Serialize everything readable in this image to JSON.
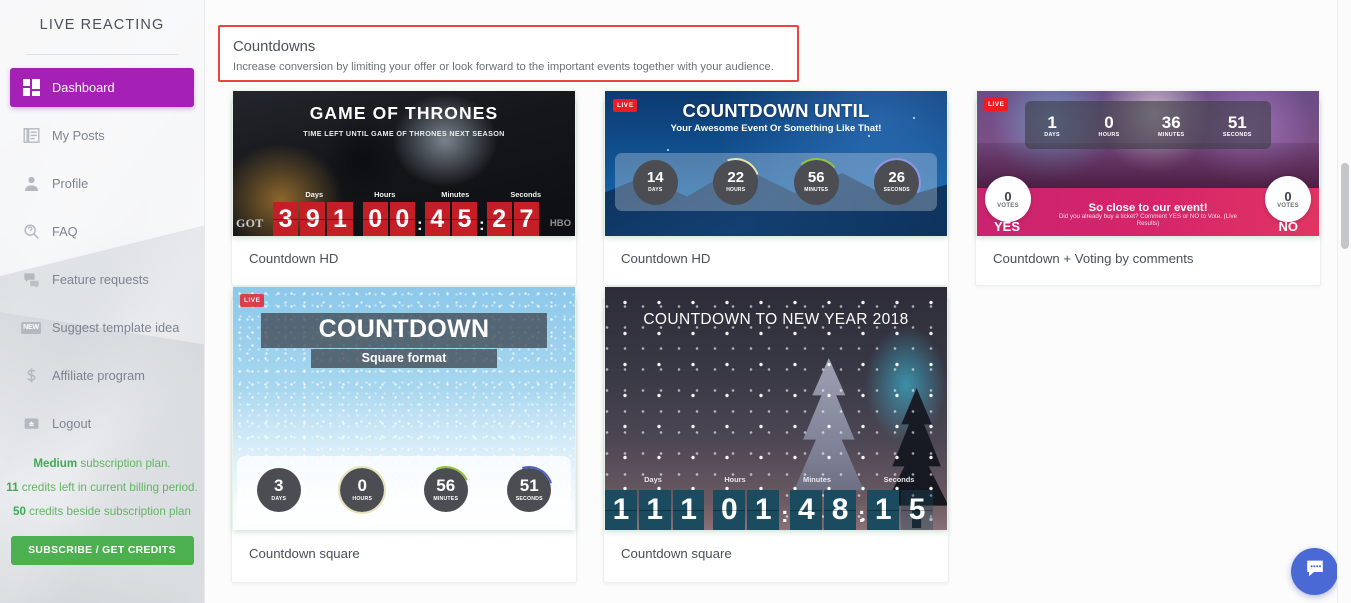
{
  "sidebar": {
    "brand": "LIVE REACTING",
    "items": [
      {
        "label": "Dashboard",
        "icon": "grid-icon",
        "active": true
      },
      {
        "label": "My Posts",
        "icon": "posts-icon",
        "active": false
      },
      {
        "label": "Profile",
        "icon": "person-icon",
        "active": false
      },
      {
        "label": "FAQ",
        "icon": "search-help-icon",
        "active": false
      },
      {
        "label": "Feature requests",
        "icon": "chat-bubbles-icon",
        "active": false
      },
      {
        "label": "Suggest template idea",
        "icon": "new-badge-icon",
        "active": false
      },
      {
        "label": "Affiliate program",
        "icon": "dollar-icon",
        "active": false
      },
      {
        "label": "Logout",
        "icon": "logout-icon",
        "active": false
      }
    ],
    "plan": {
      "line1_strong": "Medium",
      "line1_rest": " subscription plan.",
      "line2_strong": "11",
      "line2_rest": " credits left in current billing period.",
      "line3_strong": "50",
      "line3_rest": " credits beside subscription plan"
    },
    "subscribe_label": "SUBSCRIBE / GET CREDITS"
  },
  "section": {
    "title": "Countdowns",
    "subtitle": "Increase conversion by limiting your offer or look forward to the important events together with your audience.",
    "highlight_color": "#e8453c"
  },
  "colors": {
    "accent_purple": "#a520b4",
    "accent_green": "#4caf50",
    "plan_text_green": "#63b463",
    "chat_blue": "#4a69d4",
    "live_red": "#ed1c24"
  },
  "cards": [
    {
      "title": "Countdown HD"
    },
    {
      "title": "Countdown HD"
    },
    {
      "title": "Countdown + Voting by comments"
    },
    {
      "title": "Countdown square"
    },
    {
      "title": "Countdown square"
    }
  ],
  "templates": {
    "got": {
      "heading": "GAME OF THRONES",
      "subheading": "TIME LEFT UNTIL GAME OF THRONES NEXT SEASON",
      "labels": [
        "Days",
        "Hours",
        "Minutes",
        "Seconds"
      ],
      "digits": [
        "3",
        "9",
        "1",
        "0",
        "0",
        "4",
        "5",
        "2",
        "7"
      ],
      "brand_left": "GOT",
      "brand_right": "HBO"
    },
    "until": {
      "badge": "LIVE",
      "heading": "COUNTDOWN UNTIL",
      "subheading": "Your Awesome Event Or Something Like That!",
      "units": [
        {
          "value": "14",
          "unit": "DAYS"
        },
        {
          "value": "22",
          "unit": "HOURS"
        },
        {
          "value": "56",
          "unit": "MINUTES"
        },
        {
          "value": "26",
          "unit": "SECONDS"
        }
      ]
    },
    "vote": {
      "badge": "LIVE",
      "units": [
        {
          "value": "1",
          "unit": "DAYS"
        },
        {
          "value": "0",
          "unit": "HOURS"
        },
        {
          "value": "36",
          "unit": "MINUTES"
        },
        {
          "value": "51",
          "unit": "SECONDS"
        }
      ],
      "message": "So close to our event!",
      "submessage": "Did you already buy a ticket? Comment YES or NO to Vote. (Live Results)",
      "yes_votes": "0",
      "yes_unit": "VOTES",
      "yes_label": "YES",
      "no_votes": "0",
      "no_unit": "VOTES",
      "no_label": "NO"
    },
    "snow": {
      "badge": "LIVE",
      "heading": "COUNTDOWN",
      "subheading": "Square format",
      "units": [
        {
          "value": "3",
          "unit": "DAYS"
        },
        {
          "value": "0",
          "unit": "HOURS"
        },
        {
          "value": "56",
          "unit": "MINUTES"
        },
        {
          "value": "51",
          "unit": "SECONDS"
        }
      ]
    },
    "newyear": {
      "heading": "COUNTDOWN TO NEW YEAR 2018",
      "labels": [
        "Days",
        "Hours",
        "Minutes",
        "Seconds"
      ],
      "digits": [
        "1",
        "1",
        "1",
        "0",
        "1",
        "4",
        "8",
        "1",
        "5"
      ]
    }
  },
  "chat": {
    "name": "chat-launcher"
  }
}
